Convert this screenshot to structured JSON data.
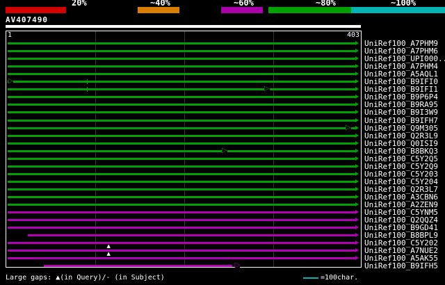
{
  "colors": {
    "green": "#00a000",
    "magenta": "#b400b4",
    "cyan": "#00b4b4",
    "red": "#d40000",
    "orange": "#d97e00",
    "scale_magenta": "#aa00aa"
  },
  "scale": {
    "labels": [
      "20%",
      "~40%",
      "~60%",
      "~80%",
      "~100%"
    ],
    "segments": [
      {
        "color": "#000000",
        "width": 8
      },
      {
        "color": "#d40000",
        "width": 87
      },
      {
        "color": "#000000",
        "width": 103
      },
      {
        "color": "#d97e00",
        "width": 60
      },
      {
        "color": "#000000",
        "width": 60
      },
      {
        "color": "#aa00aa",
        "width": 60
      },
      {
        "color": "#000000",
        "width": 8
      },
      {
        "color": "#00a000",
        "width": 119
      },
      {
        "color": "#00b4b4",
        "width": 135
      }
    ]
  },
  "query": {
    "name": "AV407490",
    "start_label": "1",
    "end_label": "403"
  },
  "legend": {
    "gaps_text": "Large gaps: ▲(in Query)/- (in Subject)",
    "scale_text": "=100char."
  },
  "chart_data": {
    "type": "bar",
    "title": "AV407490",
    "x_range": [
      1,
      403
    ],
    "identity_legend": [
      {
        "label": "20%",
        "color": "red"
      },
      {
        "label": "~40%",
        "color": "orange"
      },
      {
        "label": "~60%",
        "color": "magenta"
      },
      {
        "label": "~80%",
        "color": "green"
      },
      {
        "label": "~100%",
        "color": "cyan"
      }
    ],
    "hits": [
      {
        "label": "UniRef100_A7PHM9",
        "color": "green",
        "start": 1,
        "end": 403,
        "markers": []
      },
      {
        "label": "UniRef100_A7PHM6",
        "color": "green",
        "start": 1,
        "end": 403,
        "markers": []
      },
      {
        "label": "UniRef100_UPI000..",
        "color": "green",
        "start": 1,
        "end": 403,
        "markers": []
      },
      {
        "label": "UniRef100_A7PHM4",
        "color": "green",
        "start": 1,
        "end": 403,
        "markers": []
      },
      {
        "label": "UniRef100_A5AQL1",
        "color": "green",
        "start": 1,
        "end": 403,
        "markers": []
      },
      {
        "label": "UniRef100_B9IFI0",
        "color": "green",
        "start": 1,
        "end": 403,
        "markers": [
          {
            "type": "open-arrow",
            "pos": 4
          },
          {
            "type": "tick",
            "pos": 93
          }
        ]
      },
      {
        "label": "UniRef100_B9IFI1",
        "color": "green",
        "start": 1,
        "end": 403,
        "markers": [
          {
            "type": "tick",
            "pos": 93
          },
          {
            "type": "open-arrow",
            "pos": 300
          }
        ]
      },
      {
        "label": "UniRef100_B9P6P4",
        "color": "green",
        "start": 1,
        "end": 403,
        "markers": []
      },
      {
        "label": "UniRef100_B9RA95",
        "color": "green",
        "start": 1,
        "end": 403,
        "markers": []
      },
      {
        "label": "UniRef100_B9I3W9",
        "color": "green",
        "start": 1,
        "end": 403,
        "markers": []
      },
      {
        "label": "UniRef100_B9IFH7",
        "color": "green",
        "start": 1,
        "end": 403,
        "markers": []
      },
      {
        "label": "UniRef100_Q9M305",
        "color": "green",
        "start": 1,
        "end": 403,
        "markers": [
          {
            "type": "open-arrow",
            "pos": 394
          }
        ]
      },
      {
        "label": "UniRef100_Q2R3L9",
        "color": "green",
        "start": 1,
        "end": 403,
        "markers": []
      },
      {
        "label": "UniRef100_Q0ISI9",
        "color": "green",
        "start": 1,
        "end": 403,
        "markers": []
      },
      {
        "label": "UniRef100_B8BKQ3",
        "color": "green",
        "start": 1,
        "end": 403,
        "markers": [
          {
            "type": "open-arrow",
            "pos": 251
          }
        ]
      },
      {
        "label": "UniRef100_C5Y2Q5",
        "color": "green",
        "start": 1,
        "end": 403,
        "markers": []
      },
      {
        "label": "UniRef100_C5Y2Q9",
        "color": "green",
        "start": 1,
        "end": 403,
        "markers": []
      },
      {
        "label": "UniRef100_C5Y203",
        "color": "green",
        "start": 1,
        "end": 403,
        "markers": []
      },
      {
        "label": "UniRef100_C5Y204",
        "color": "green",
        "start": 1,
        "end": 403,
        "markers": []
      },
      {
        "label": "UniRef100_Q2R3L7",
        "color": "green",
        "start": 1,
        "end": 403,
        "markers": []
      },
      {
        "label": "UniRef100_A3CBN6",
        "color": "green",
        "start": 1,
        "end": 403,
        "markers": []
      },
      {
        "label": "UniRef100_A2ZEN9",
        "color": "green",
        "start": 1,
        "end": 403,
        "markers": []
      },
      {
        "label": "UniRef100_C5YNM5",
        "color": "magenta",
        "start": 1,
        "end": 403,
        "markers": []
      },
      {
        "label": "UniRef100_Q2QQZ4",
        "color": "magenta",
        "start": 1,
        "end": 403,
        "markers": []
      },
      {
        "label": "UniRef100_B9GD41",
        "color": "magenta",
        "start": 1,
        "end": 403,
        "markers": []
      },
      {
        "label": "UniRef100_B8BPL9",
        "color": "magenta",
        "start": 24,
        "end": 403,
        "markers": []
      },
      {
        "label": "UniRef100_C5Y202",
        "color": "magenta",
        "start": 1,
        "end": 403,
        "markers": [
          {
            "type": "gap-up",
            "pos": 118
          }
        ]
      },
      {
        "label": "UniRef100_A7NUE2",
        "color": "magenta",
        "start": 1,
        "end": 403,
        "markers": [
          {
            "type": "gap-up",
            "pos": 118
          }
        ]
      },
      {
        "label": "UniRef100_A5AK55",
        "color": "magenta",
        "start": 1,
        "end": 403,
        "markers": []
      },
      {
        "label": "UniRef100_B9IFH5",
        "color": "magenta",
        "start": 43,
        "end": 261,
        "markers": [
          {
            "type": "open-arrow",
            "pos": 266
          }
        ]
      }
    ]
  }
}
